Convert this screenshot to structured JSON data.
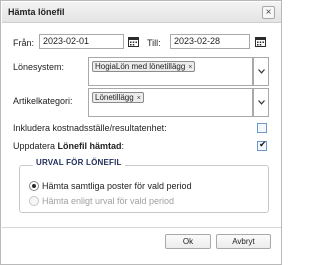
{
  "dialog": {
    "title": "Hämta lönefil",
    "close_glyph": "×"
  },
  "dates": {
    "from_label": "Från:",
    "from_value": "2023-02-01",
    "to_label": "Till:",
    "to_value": "2023-02-28"
  },
  "lonesystem": {
    "label": "Lönesystem:",
    "selected": [
      "HogiaLön med lönetillägg"
    ]
  },
  "artikelkategori": {
    "label": "Artikelkategori:",
    "selected": [
      "Lönetillägg"
    ]
  },
  "options": {
    "include_cost_label": "Inkludera kostnadsställe/resultatenhet:",
    "include_cost_checked": false,
    "update_label_prefix": "Uppdatera ",
    "update_label_bold": "Lönefil hämtad",
    "update_label_suffix": ":",
    "update_checked": true
  },
  "urval": {
    "title": "URVAL FÖR LÖNEFIL",
    "option_all": "Hämta samtliga poster för vald period",
    "option_filtered": "Hämta enligt urval för vald period",
    "selected": "all"
  },
  "buttons": {
    "ok": "Ok",
    "cancel": "Avbryt"
  },
  "colors": {
    "checkbox_border": "#6f95c8",
    "group_title": "#1f2d5a"
  },
  "icons": [
    "close-icon",
    "calendar-icon",
    "chevron-down-icon",
    "tag-remove-icon",
    "checkmark-icon"
  ]
}
